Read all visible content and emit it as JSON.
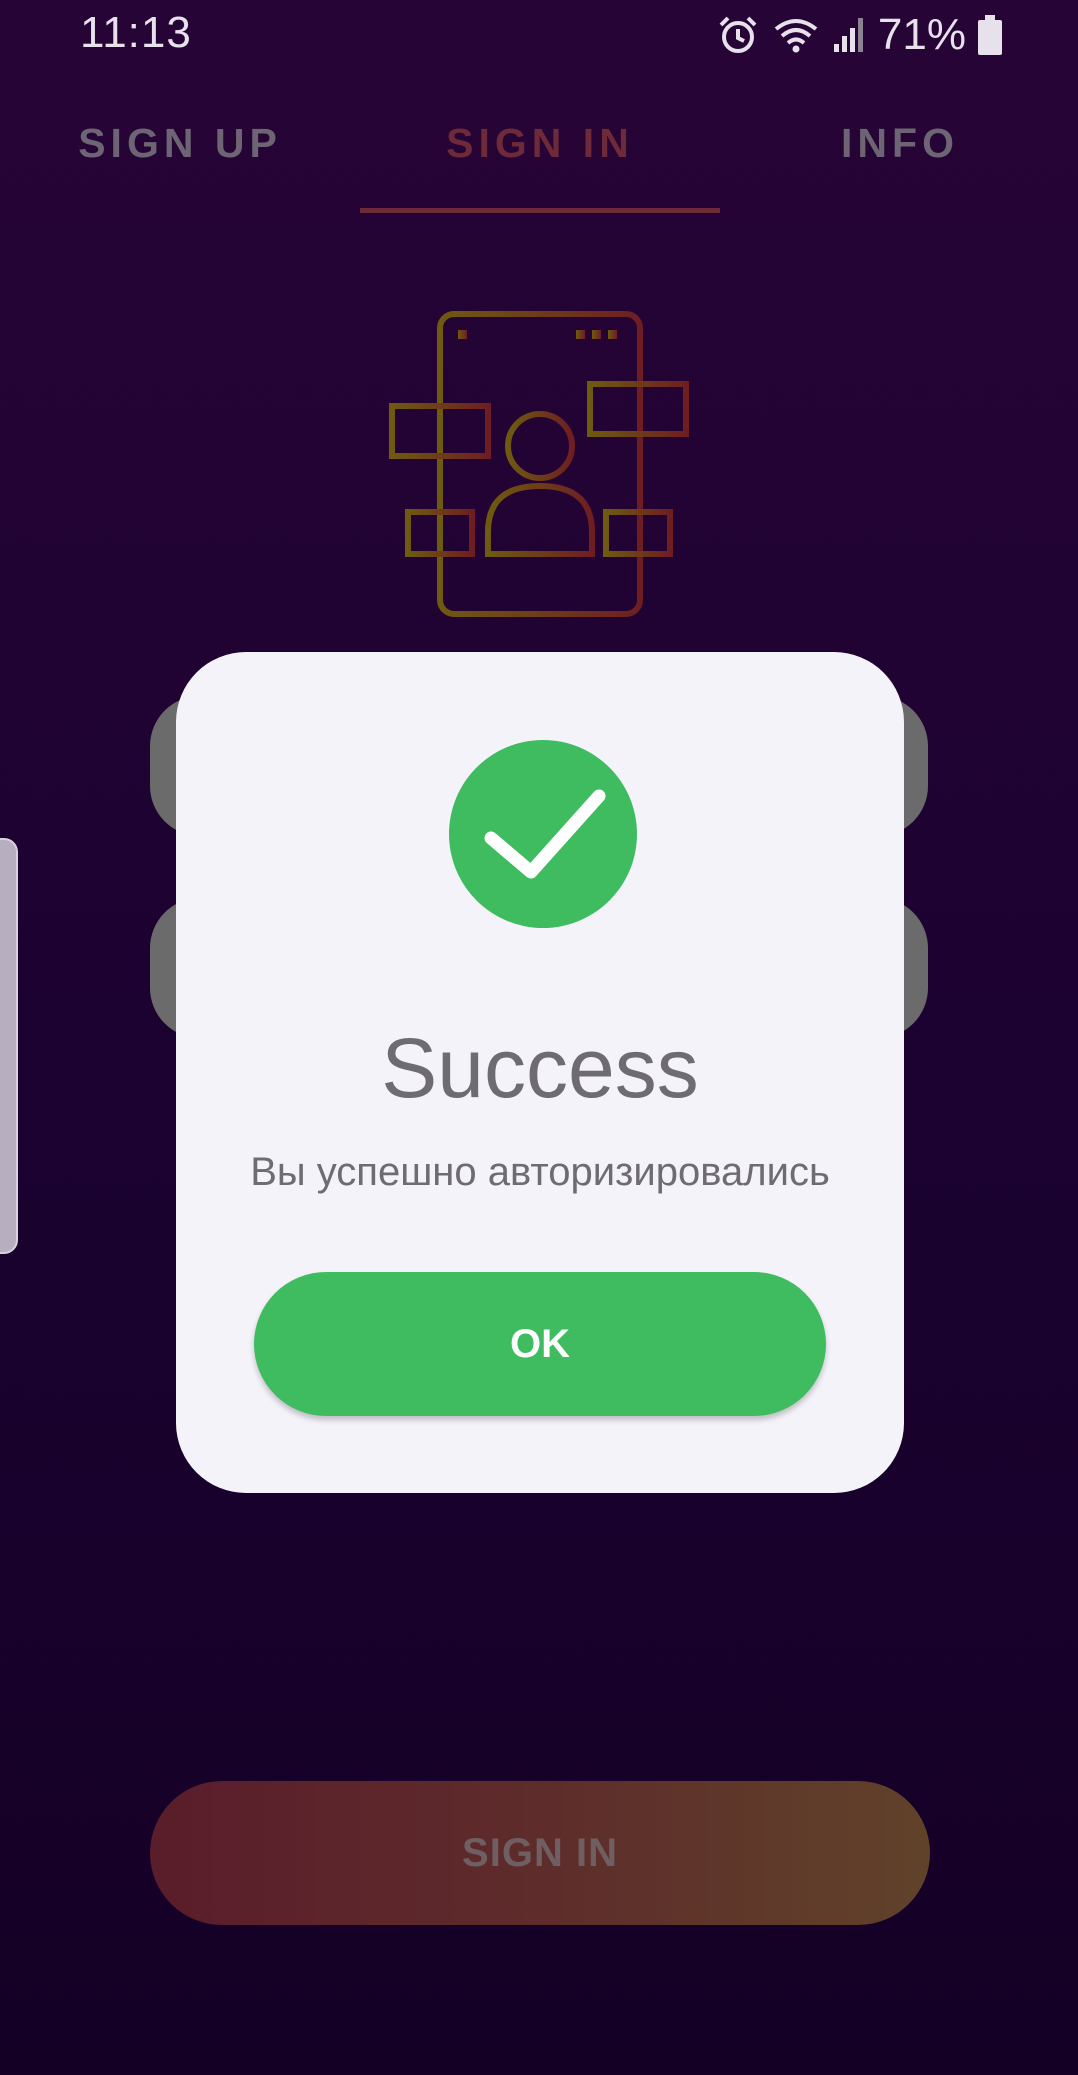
{
  "status_bar": {
    "time": "11:13",
    "battery": "71%",
    "icons": [
      "alarm-icon",
      "wifi-icon",
      "signal-icon",
      "battery-icon"
    ]
  },
  "tabs": [
    {
      "label": "SIGN UP"
    },
    {
      "label": "SIGN IN"
    },
    {
      "label": "INFO"
    }
  ],
  "sign_in_button": {
    "label": "SIGN IN"
  },
  "dialog": {
    "title": "Success",
    "message": "Вы успешно авторизировались",
    "ok_label": "OK"
  },
  "colors": {
    "background": "#1b0230",
    "success": "#3ebc5f",
    "dialog_bg": "#f4f3f9",
    "active_tab": "#6f2a3a"
  }
}
